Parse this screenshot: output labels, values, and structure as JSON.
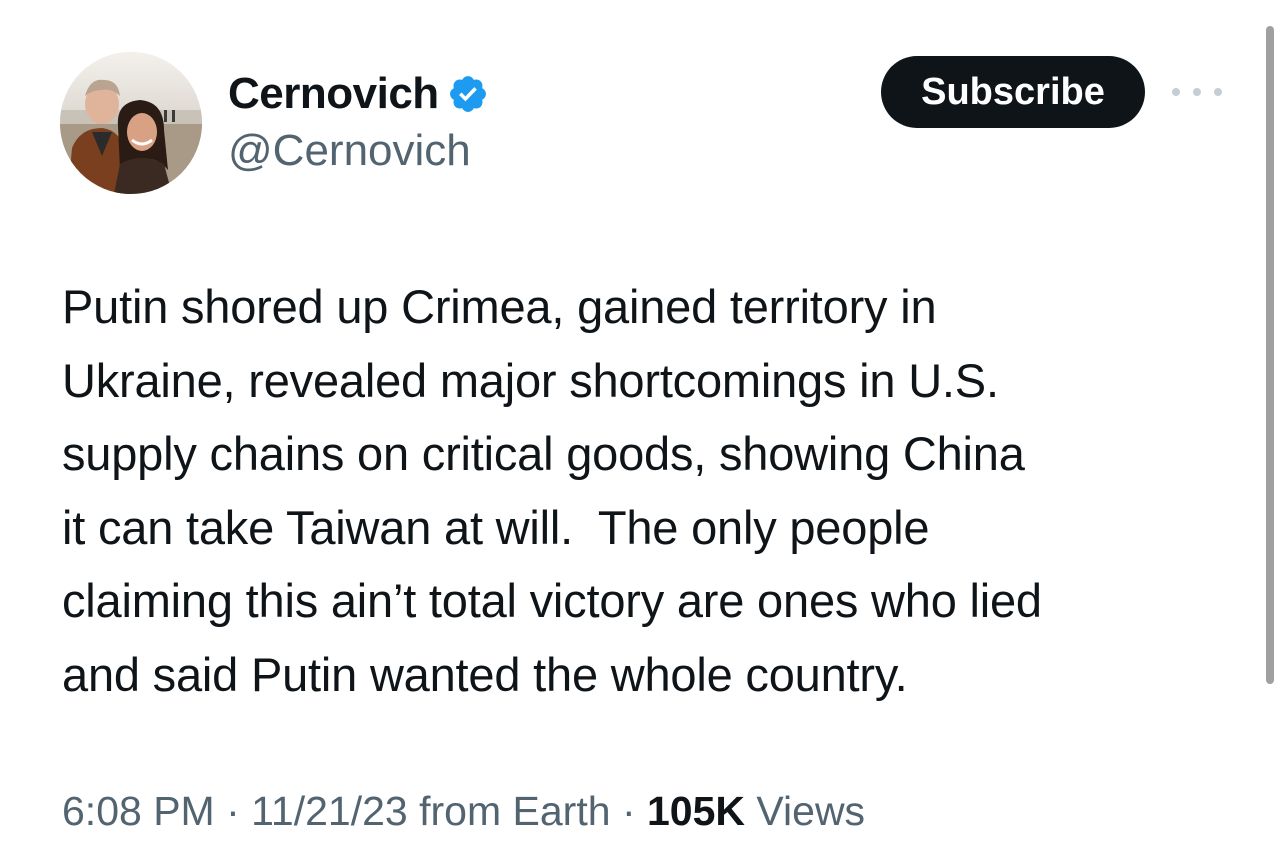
{
  "author": {
    "display_name": "Cernovich",
    "handle": "@Cernovich",
    "verified_icon": "verified-badge-icon",
    "badge_color": "#1d9bf0"
  },
  "actions": {
    "subscribe_label": "Subscribe",
    "more_icon": "more-horizontal-icon"
  },
  "tweet": {
    "text": "Putin shored up Crimea, gained territory in\nUkraine, revealed major shortcomings in U.S.\nsupply chains on critical goods, showing China\nit can take Taiwan at will.  The only people\nclaiming this ain’t total victory are ones who lied\nand said Putin wanted the whole country.",
    "time": "6:08 PM",
    "separator": "·",
    "date": "11/21/23",
    "source": "from Earth",
    "views_count": "105K",
    "views_label": "Views"
  },
  "colors": {
    "text_primary": "#0f1419",
    "text_secondary": "#536471",
    "button_bg": "#0f1419",
    "button_text": "#ffffff"
  }
}
